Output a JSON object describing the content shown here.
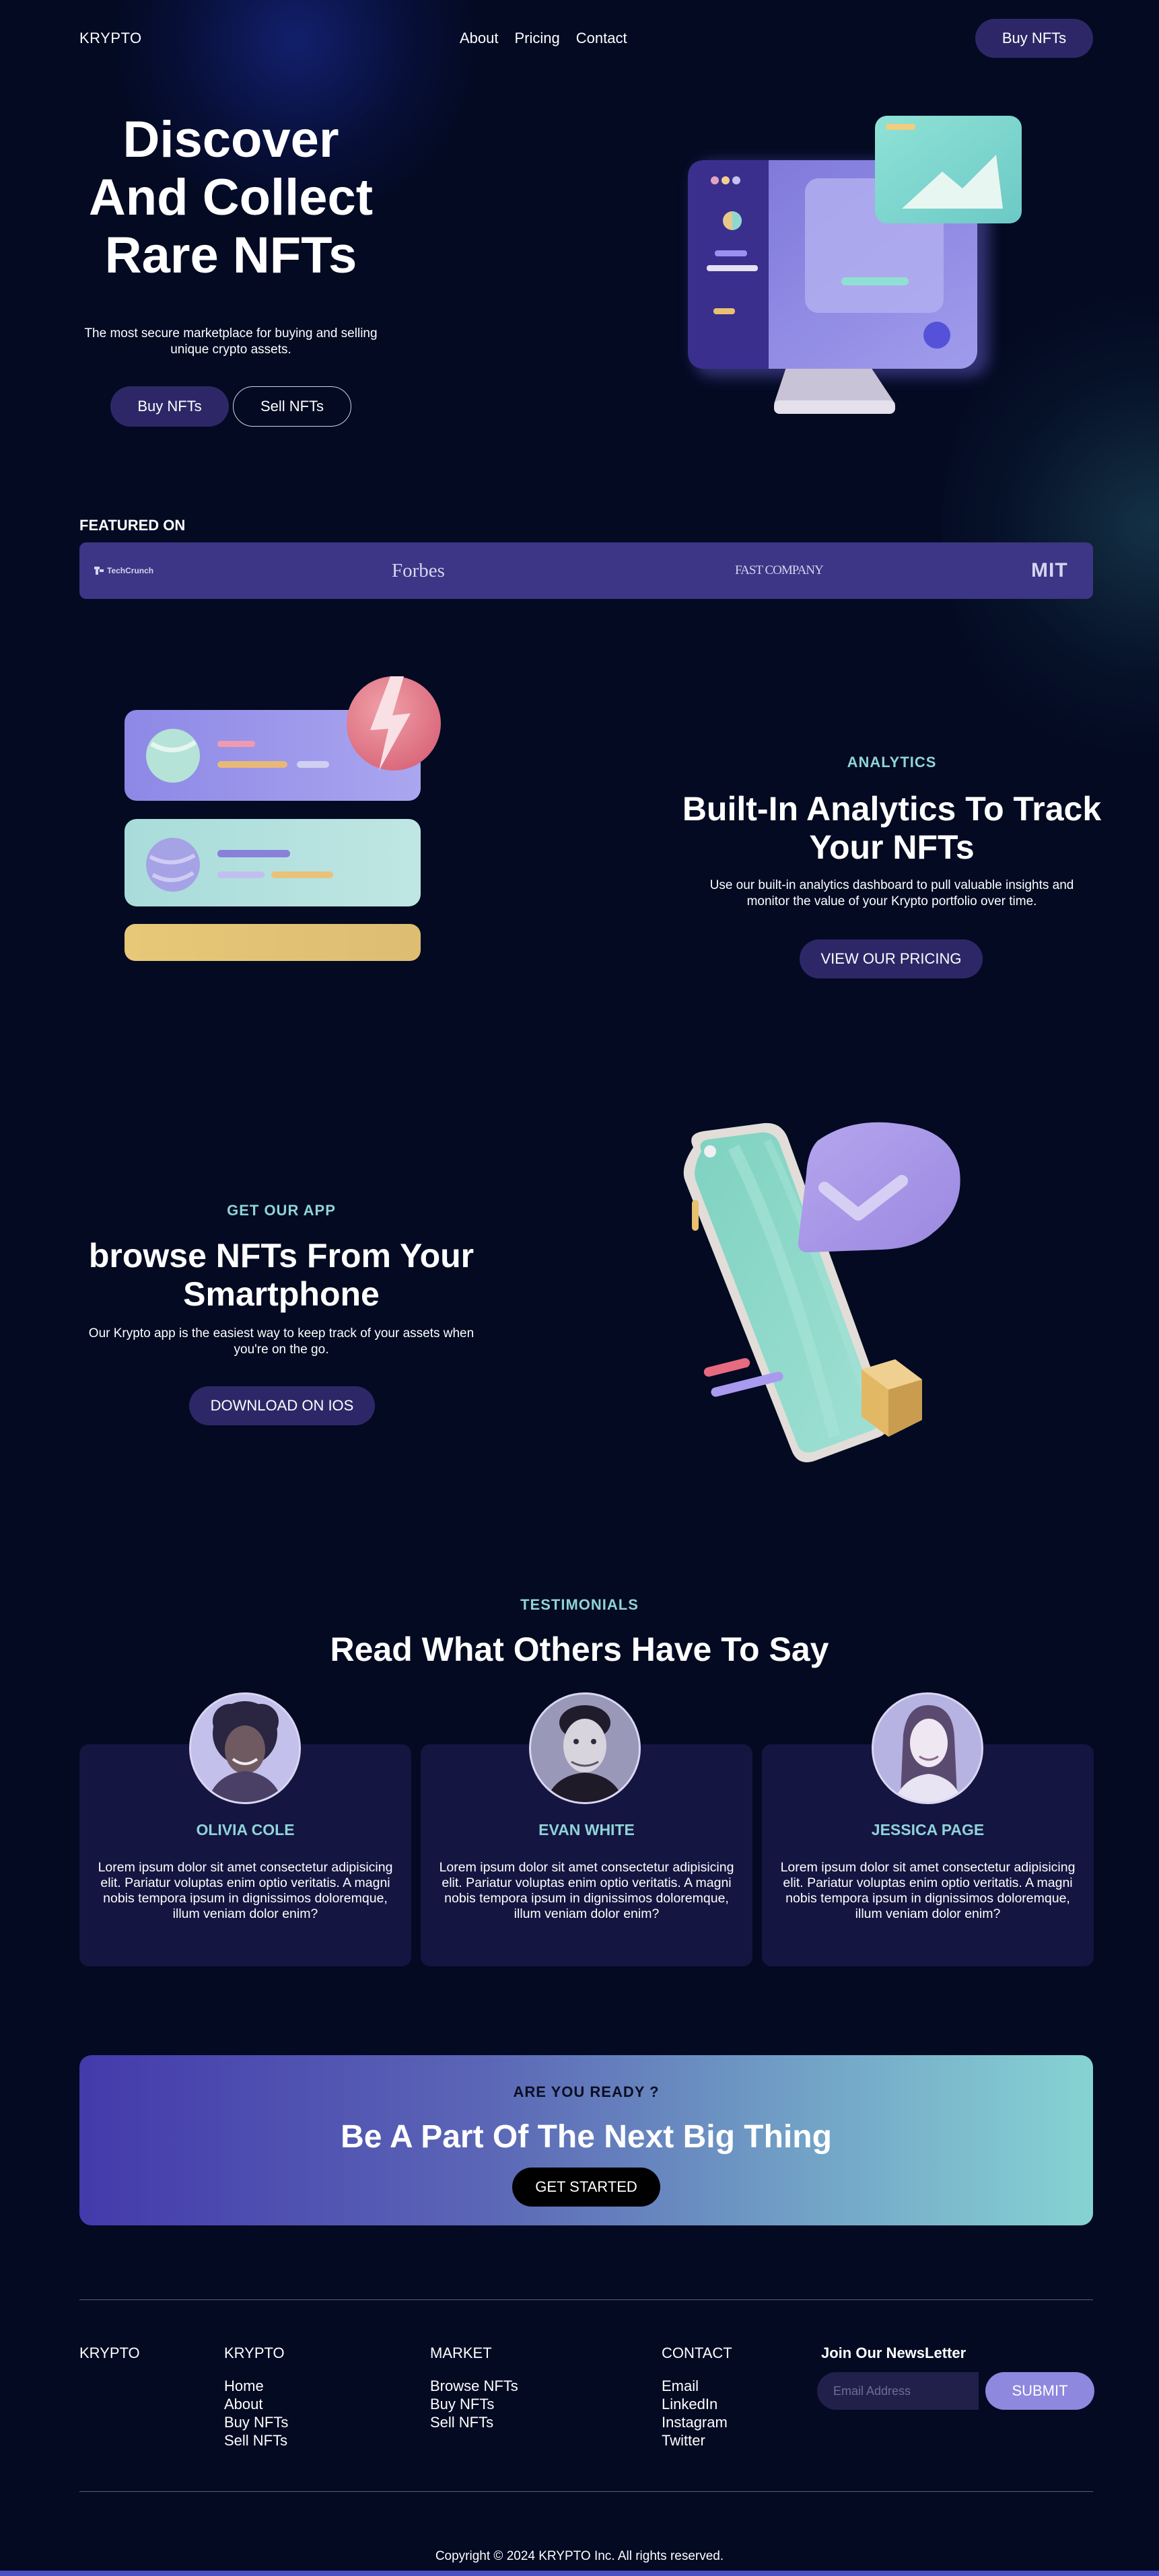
{
  "brand": "KRYPTO",
  "colors": {
    "background": "#030a22",
    "accent": "#2e2767",
    "teal": "#8fd3d9",
    "feature_bar": "#3d3585",
    "card": "#151541"
  },
  "nav": {
    "items": [
      "About",
      "Pricing",
      "Contact"
    ],
    "cta": "Buy NFTs"
  },
  "hero": {
    "title_lines": [
      "Discover",
      "And Collect",
      "Rare NFTs"
    ],
    "subtitle": "The most secure marketplace for buying and selling unique crypto assets.",
    "buy_label": "Buy NFTs",
    "sell_label": "Sell NFTs"
  },
  "featured": {
    "label": "FEATURED ON",
    "logos": [
      "TechCrunch",
      "Forbes",
      "FAST COMPANY",
      "MIT"
    ]
  },
  "analytics": {
    "label": "ANALYTICS",
    "title": "Built-In Analytics To Track Your NFTs",
    "subtitle": "Use our built-in analytics dashboard to pull valuable insights and monitor the value of your Krypto portfolio over time.",
    "button": "VIEW OUR PRICING"
  },
  "app": {
    "label": "GET OUR APP",
    "title": "browse NFTs From Your Smartphone",
    "subtitle": "Our Krypto app is the easiest way to keep track of your assets when you're on the go.",
    "button": "DOWNLOAD ON IOS"
  },
  "testimonials": {
    "label": "TESTIMONIALS",
    "title": "Read What Others Have To Say",
    "items": [
      {
        "name": "OLIVIA COLE",
        "quote": "Lorem ipsum dolor sit amet consectetur adipisicing elit. Pariatur voluptas enim optio veritatis. A magni nobis tempora ipsum in dignissimos doloremque, illum veniam dolor enim?"
      },
      {
        "name": "EVAN WHITE",
        "quote": "Lorem ipsum dolor sit amet consectetur adipisicing elit. Pariatur voluptas enim optio veritatis. A magni nobis tempora ipsum in dignissimos doloremque, illum veniam dolor enim?"
      },
      {
        "name": "JESSICA PAGE",
        "quote": "Lorem ipsum dolor sit amet consectetur adipisicing elit. Pariatur voluptas enim optio veritatis. A magni nobis tempora ipsum in dignissimos doloremque, illum veniam dolor enim?"
      }
    ]
  },
  "cta": {
    "label": "ARE YOU READY ?",
    "title": "Be A Part Of The Next Big Thing",
    "button": "GET STARTED"
  },
  "footer": {
    "logo": "KRYPTO",
    "columns": [
      {
        "heading": "KRYPTO",
        "links": [
          "Home",
          "About",
          "Buy NFTs",
          "Sell NFTs"
        ]
      },
      {
        "heading": "MARKET",
        "links": [
          "Browse NFTs",
          "Buy NFTs",
          "Sell NFTs"
        ]
      },
      {
        "heading": "CONTACT",
        "links": [
          "Email",
          "LinkedIn",
          "Instagram",
          "Twitter"
        ]
      }
    ],
    "newsletter": {
      "title": "Join Our NewsLetter",
      "placeholder": "Email Address",
      "button": "SUBMIT"
    },
    "copyright": "Copyright © 2024 KRYPTO Inc. All rights reserved."
  }
}
